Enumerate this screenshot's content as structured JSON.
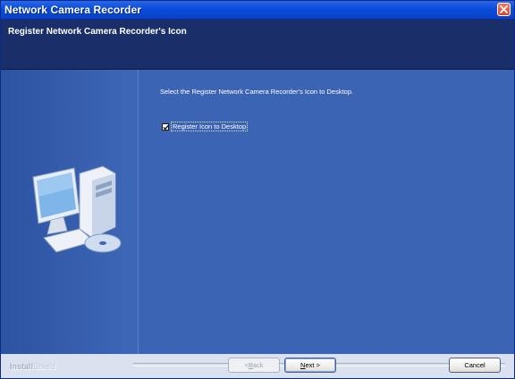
{
  "window": {
    "title": "Network Camera Recorder",
    "accent_color": "#0a4cd8",
    "close_icon": "close-icon"
  },
  "header": {
    "title": "Register Network Camera Recorder's Icon"
  },
  "body": {
    "prompt": "Select the Register Network Camera Recorder's Icon to Desktop.",
    "checkbox": {
      "label": "Register Icon to Desktop",
      "checked": true
    },
    "illustration_icon": "computer-with-cd-icon"
  },
  "footer": {
    "brand_install": "Install",
    "brand_shield": "Shield",
    "back_label_prefix": "< ",
    "back_label_hotkey": "B",
    "back_label_rest": "ack",
    "next_label_hotkey": "N",
    "next_label_rest": "ext >",
    "cancel_label": "Cancel"
  }
}
